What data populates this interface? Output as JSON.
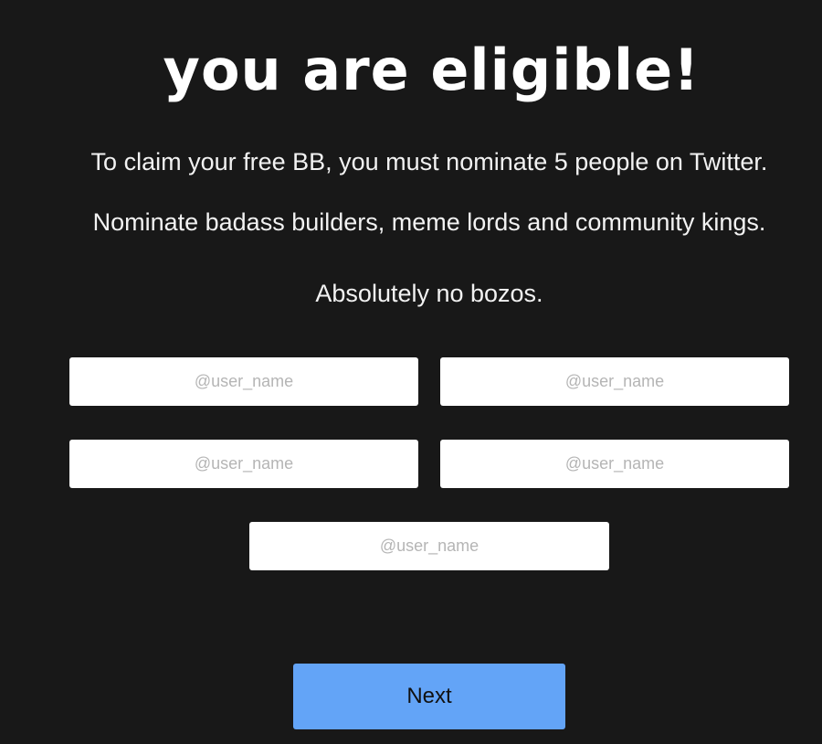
{
  "header": {
    "title": "you are eligible!"
  },
  "instructions": {
    "line1": "To claim your free BB, you must nominate 5 people on Twitter.",
    "line2": "Nominate badass builders, meme lords and community kings.",
    "line3": "Absolutely no bozos."
  },
  "nominations": {
    "fields": [
      {
        "value": "",
        "placeholder": "@user_name"
      },
      {
        "value": "",
        "placeholder": "@user_name"
      },
      {
        "value": "",
        "placeholder": "@user_name"
      },
      {
        "value": "",
        "placeholder": "@user_name"
      },
      {
        "value": "",
        "placeholder": "@user_name"
      }
    ]
  },
  "actions": {
    "next_label": "Next"
  },
  "colors": {
    "background": "#181818",
    "button": "#63a4f7",
    "field": "#ffffff",
    "placeholder": "#b5b5b5"
  }
}
